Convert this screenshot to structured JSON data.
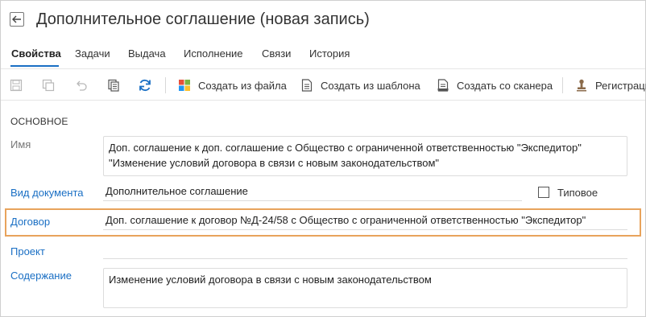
{
  "header": {
    "title": "Дополнительное соглашение (новая запись)"
  },
  "tabs": [
    {
      "label": "Свойства",
      "active": true
    },
    {
      "label": "Задачи",
      "active": false
    },
    {
      "label": "Выдача",
      "active": false
    },
    {
      "label": "Исполнение",
      "active": false
    },
    {
      "label": "Связи",
      "active": false
    },
    {
      "label": "История",
      "active": false
    }
  ],
  "toolbar": {
    "icons": [
      "save-icon",
      "save-and-close-icon",
      "undo-icon",
      "copy-icon",
      "refresh-icon"
    ],
    "create_from_file": "Создать из файла",
    "create_from_template": "Создать из шаблона",
    "create_from_scanner": "Создать со сканера",
    "registration": "Регистраци"
  },
  "form": {
    "section_title": "ОСНОВНОЕ",
    "name": {
      "label": "Имя",
      "line1": "Доп. соглашение к доп. соглашение с Общество с ограниченной ответственностью \"Экспедитор\"",
      "line2": "\"Изменение условий договора в связи с новым законодательством\""
    },
    "doc_type": {
      "label": "Вид документа",
      "value": "Дополнительное соглашение"
    },
    "typical": {
      "label": "Типовое",
      "checked": false
    },
    "contract": {
      "label": "Договор",
      "value": "Доп. соглашение к договор №Д-24/58 с Общество с ограниченной ответственностью \"Экспедитор\""
    },
    "project": {
      "label": "Проект",
      "value": ""
    },
    "content": {
      "label": "Содержание",
      "value": "Изменение условий договора в связи с новым законодательством"
    }
  },
  "colors": {
    "accent": "#1a6fc4",
    "highlight": "#e8a35c"
  }
}
